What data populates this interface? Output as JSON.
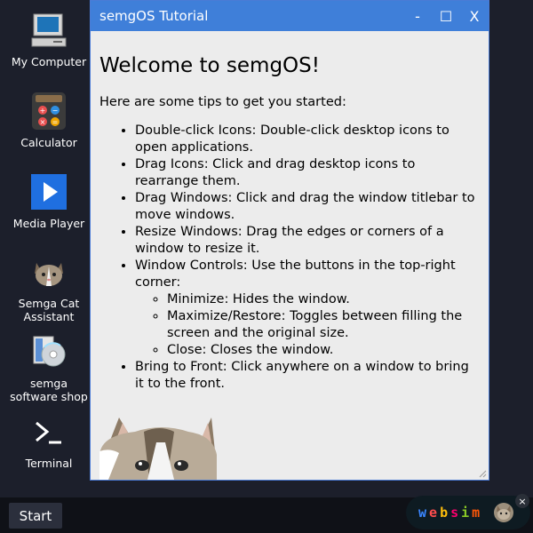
{
  "desktop": {
    "icons": [
      {
        "label": "My Computer",
        "icon": "computer-icon"
      },
      {
        "label": "Calculator",
        "icon": "calculator-icon"
      },
      {
        "label": "Media Player",
        "icon": "media-player-icon"
      },
      {
        "label": "Semga Cat Assistant",
        "icon": "cat-icon"
      },
      {
        "label": "semga software shop",
        "icon": "software-shop-icon"
      },
      {
        "label": "Terminal",
        "icon": "terminal-icon"
      }
    ]
  },
  "window": {
    "title": "semgOS Tutorial",
    "heading": "Welcome to semgOS!",
    "intro": "Here are some tips to get you started:",
    "tips": [
      "Double-click Icons: Double-click desktop icons to open applications.",
      "Drag Icons: Click and drag desktop icons to rearrange them.",
      "Drag Windows: Click and drag the window titlebar to move windows.",
      "Resize Windows: Drag the edges or corners of a window to resize it.",
      "Window Controls: Use the buttons in the top-right corner:",
      "Bring to Front: Click anywhere on a window to bring it to the front."
    ],
    "controls": [
      "Minimize: Hides the window.",
      "Maximize/Restore: Toggles between filling the screen and the original size.",
      "Close: Closes the window."
    ],
    "buttons": {
      "minimize": "-",
      "maximize": "☐",
      "close": "X"
    }
  },
  "taskbar": {
    "start_label": "Start"
  },
  "websim": {
    "letters": [
      "w",
      "e",
      "b",
      "s",
      "i",
      "m"
    ],
    "colors": [
      "#3a86ff",
      "#ff4d4d",
      "#ffbe0b",
      "#ff006e",
      "#8ac926",
      "#fb5607"
    ],
    "close": "×"
  },
  "colors": {
    "titlebar": "#3f7fd9",
    "desktop": "#1c1f2b",
    "taskbar": "#0f1117"
  }
}
